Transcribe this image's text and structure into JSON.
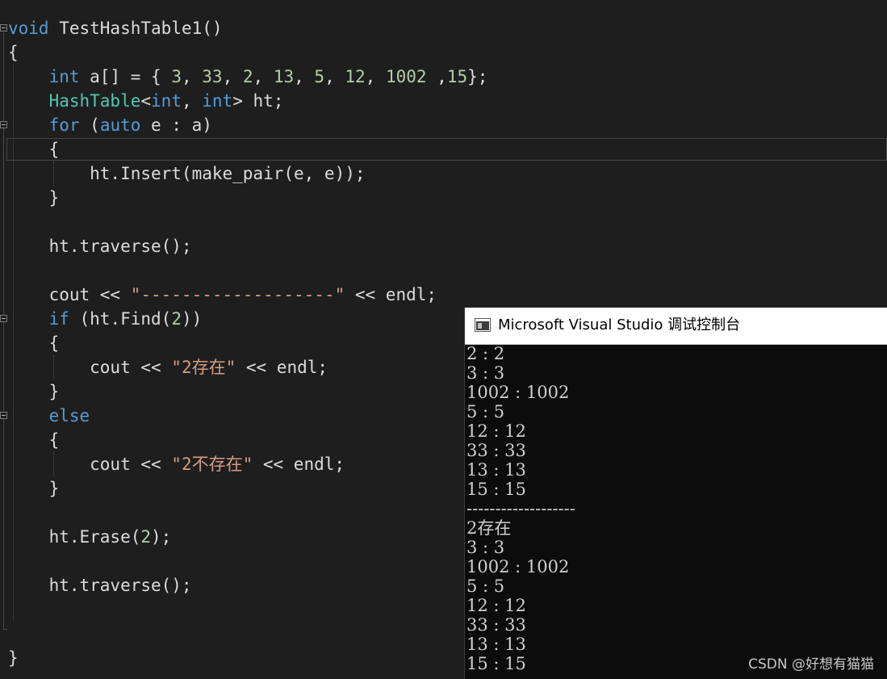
{
  "code_lines": [
    {
      "tokens": [
        {
          "t": "void",
          "c": "kw"
        },
        {
          "t": " TestHashTable1()",
          "c": "tx"
        }
      ]
    },
    {
      "tokens": [
        {
          "t": "{",
          "c": "tx"
        }
      ]
    },
    {
      "tokens": [
        {
          "t": "    ",
          "c": "tx"
        },
        {
          "t": "int",
          "c": "kw"
        },
        {
          "t": " a[] = { ",
          "c": "tx"
        },
        {
          "t": "3",
          "c": "nm"
        },
        {
          "t": ", ",
          "c": "tx"
        },
        {
          "t": "33",
          "c": "nm"
        },
        {
          "t": ", ",
          "c": "tx"
        },
        {
          "t": "2",
          "c": "nm"
        },
        {
          "t": ", ",
          "c": "tx"
        },
        {
          "t": "13",
          "c": "nm"
        },
        {
          "t": ", ",
          "c": "tx"
        },
        {
          "t": "5",
          "c": "nm"
        },
        {
          "t": ", ",
          "c": "tx"
        },
        {
          "t": "12",
          "c": "nm"
        },
        {
          "t": ", ",
          "c": "tx"
        },
        {
          "t": "1002",
          "c": "nm"
        },
        {
          "t": " ,",
          "c": "tx"
        },
        {
          "t": "15",
          "c": "nm"
        },
        {
          "t": "};",
          "c": "tx"
        }
      ]
    },
    {
      "tokens": [
        {
          "t": "    ",
          "c": "tx"
        },
        {
          "t": "HashTable",
          "c": "ty"
        },
        {
          "t": "<",
          "c": "tx"
        },
        {
          "t": "int",
          "c": "kw"
        },
        {
          "t": ", ",
          "c": "tx"
        },
        {
          "t": "int",
          "c": "kw"
        },
        {
          "t": "> ht;",
          "c": "tx"
        }
      ]
    },
    {
      "tokens": [
        {
          "t": "    ",
          "c": "tx"
        },
        {
          "t": "for",
          "c": "kw"
        },
        {
          "t": " (",
          "c": "tx"
        },
        {
          "t": "auto",
          "c": "kw"
        },
        {
          "t": " e : a)",
          "c": "tx"
        }
      ]
    },
    {
      "tokens": [
        {
          "t": "    {",
          "c": "tx"
        }
      ]
    },
    {
      "tokens": [
        {
          "t": "        ht.Insert(make_pair(e, e));",
          "c": "tx"
        }
      ]
    },
    {
      "tokens": [
        {
          "t": "    }",
          "c": "tx"
        }
      ]
    },
    {
      "tokens": []
    },
    {
      "tokens": [
        {
          "t": "    ht.traverse();",
          "c": "tx"
        }
      ]
    },
    {
      "tokens": []
    },
    {
      "tokens": [
        {
          "t": "    cout << ",
          "c": "tx"
        },
        {
          "t": "\"-------------------\"",
          "c": "st"
        },
        {
          "t": " << endl;",
          "c": "tx"
        }
      ]
    },
    {
      "tokens": [
        {
          "t": "    ",
          "c": "tx"
        },
        {
          "t": "if",
          "c": "kw"
        },
        {
          "t": " (ht.Find(",
          "c": "tx"
        },
        {
          "t": "2",
          "c": "nm"
        },
        {
          "t": "))",
          "c": "tx"
        }
      ]
    },
    {
      "tokens": [
        {
          "t": "    {",
          "c": "tx"
        }
      ]
    },
    {
      "tokens": [
        {
          "t": "        cout << ",
          "c": "tx"
        },
        {
          "t": "\"2存在\"",
          "c": "st"
        },
        {
          "t": " << endl;",
          "c": "tx"
        }
      ]
    },
    {
      "tokens": [
        {
          "t": "    }",
          "c": "tx"
        }
      ]
    },
    {
      "tokens": [
        {
          "t": "    ",
          "c": "tx"
        },
        {
          "t": "else",
          "c": "kw"
        }
      ]
    },
    {
      "tokens": [
        {
          "t": "    {",
          "c": "tx"
        }
      ]
    },
    {
      "tokens": [
        {
          "t": "        cout << ",
          "c": "tx"
        },
        {
          "t": "\"2不存在\"",
          "c": "st"
        },
        {
          "t": " << endl;",
          "c": "tx"
        }
      ]
    },
    {
      "tokens": [
        {
          "t": "    }",
          "c": "tx"
        }
      ]
    },
    {
      "tokens": []
    },
    {
      "tokens": [
        {
          "t": "    ht.Erase(",
          "c": "tx"
        },
        {
          "t": "2",
          "c": "nm"
        },
        {
          "t": ");",
          "c": "tx"
        }
      ]
    },
    {
      "tokens": []
    },
    {
      "tokens": [
        {
          "t": "    ht.traverse();",
          "c": "tx"
        }
      ]
    },
    {
      "tokens": []
    },
    {
      "tokens": []
    },
    {
      "tokens": [
        {
          "t": "}",
          "c": "tx"
        }
      ]
    }
  ],
  "console": {
    "title": "Microsoft Visual Studio 调试控制台",
    "lines": [
      "2 : 2",
      "3 : 3",
      "1002 : 1002",
      "5 : 5",
      "12 : 12",
      "33 : 33",
      "13 : 13",
      "15 : 15",
      "-------------------",
      "2存在",
      "3 : 3",
      "1002 : 1002",
      "5 : 5",
      "12 : 12",
      "33 : 33",
      "13 : 13",
      "15 : 15"
    ]
  },
  "watermark": "CSDN @好想有猫猫",
  "colors": {
    "editor_background": "#1e1e1e",
    "keyword": "#569cd6",
    "type": "#4ec9b0",
    "number": "#b5cea8",
    "string": "#d69d85",
    "text": "#dcdcdc",
    "console_background": "#0c0c0c",
    "console_text": "#d0d0d0"
  }
}
